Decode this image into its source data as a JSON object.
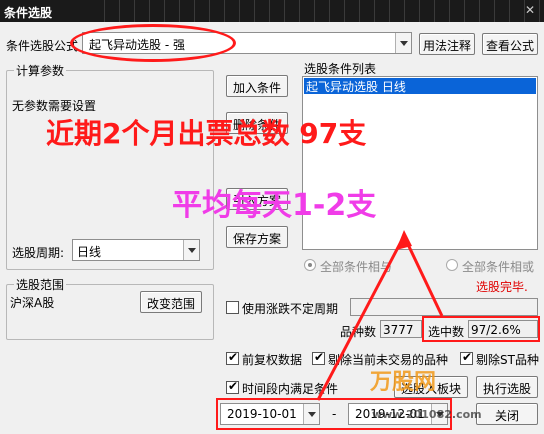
{
  "window": {
    "title": "条件选股"
  },
  "formula": {
    "label": "条件选股公式",
    "value": "起飞异动选股 - 强",
    "usage_button": "用法注释",
    "view_button": "查看公式"
  },
  "params": {
    "group_title": "计算参数",
    "no_params_text": "无参数需要设置",
    "period_label": "选股周期:",
    "period_value": "日线"
  },
  "actions": {
    "add": "加入条件",
    "delete": "删除条件",
    "load": "引入方案",
    "save": "保存方案"
  },
  "conditions": {
    "title": "选股条件列表",
    "items": [
      "起飞异动选股  日线"
    ],
    "mode_all_and": "全部条件相与",
    "mode_all_or": "全部条件相或",
    "status": "选股完毕."
  },
  "range": {
    "group_title": "选股范围",
    "value": "沪深A股",
    "change_button": "改变范围"
  },
  "options": {
    "use_limit_cycle": "使用涨跌不定周期",
    "forward_adjust": "前复权数据",
    "exclude_untraded": "剔除当前未交易的品种",
    "exclude_st": "剔除ST品种",
    "time_range": "时间段内满足条件"
  },
  "stats": {
    "count_label": "品种数",
    "count_value": "3777",
    "selected_label": "选中数",
    "selected_value": "97/2.6%"
  },
  "dates": {
    "start": "2019-10-01",
    "end": "2019-12-01",
    "separator": "-"
  },
  "bottom": {
    "to_block": "选股入板块",
    "execute": "执行选股",
    "close": "关闭"
  },
  "annotations": {
    "headline": "近期2个月出票总数 97支",
    "subline": "平均每天1-2支"
  },
  "watermark": {
    "logo": "万股网",
    "url": "www.201082.com"
  },
  "colors": {
    "annotation_red": "#ff1a1a",
    "annotation_pink": "#f03ce8",
    "selection_blue": "#0a64d8",
    "status_red": "#e00000"
  }
}
